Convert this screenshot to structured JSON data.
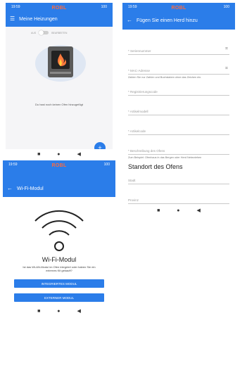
{
  "phone1": {
    "status": {
      "time": "19:59",
      "right": "100"
    },
    "brand": "ROBL",
    "title": "Meine Heizungen",
    "toggle": {
      "left": "AUS",
      "right": "BEARBEITEN"
    },
    "empty_text": "Du hast noch keinen Ofen hinzugefügt",
    "fab": "+"
  },
  "phone2": {
    "status": {
      "time": "19:59",
      "right": "100"
    },
    "brand": "ROBL",
    "title": "Fügen Sie einen Herd hinzu",
    "fields": [
      {
        "label": "* Seriennummer"
      },
      {
        "label": "* MAC-Adresse"
      }
    ],
    "mac_help": "Zahlen Sie nur Zahlen und Buchstaben ohne das Zeichen ein.",
    "fields2": [
      {
        "label": "* Registrierungscode"
      },
      {
        "label": "* Artikelmodell"
      },
      {
        "label": "* Artikelcode"
      },
      {
        "label": "* Beschreibung des Ofens"
      }
    ],
    "desc_help": "Zum Beispiel: Ofenhaus in das Bergen oder Herd Nebeziehen",
    "section_title": "Standort des Ofens",
    "location_fields": [
      {
        "label": "Stadt"
      },
      {
        "label": "Provinz"
      }
    ]
  },
  "phone3": {
    "status": {
      "time": "19:59",
      "right": "100"
    },
    "brand": "ROBL",
    "title": "Wi-Fi-Modul",
    "heading": "Wi-Fi-Modul",
    "question": "Ist das WLAN-Modul im Ofen integriert oder haben Sie ein externes Kit gekauft?",
    "button_internal": "INTEGRIERTES MODUL",
    "button_external": "EXTERNER MODUL"
  },
  "colors": {
    "primary": "#2b7de9",
    "brand": "#ff6a3d"
  }
}
